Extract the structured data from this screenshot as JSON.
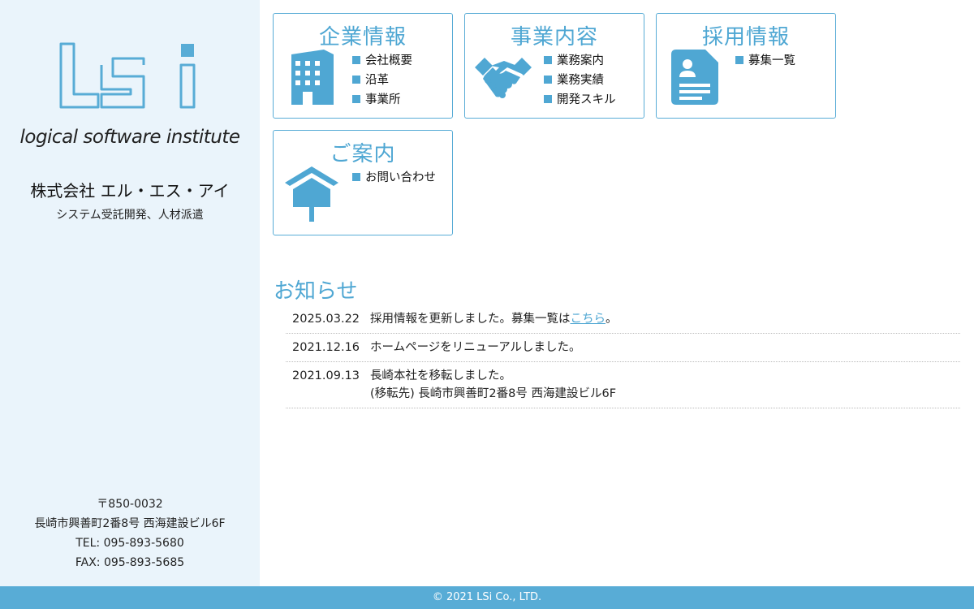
{
  "sidebar": {
    "logo_text": "LSi",
    "tagline": "logical software institute",
    "company_name": "株式会社 エル・エス・アイ",
    "subtitle": "システム受託開発、人材派遣",
    "address": {
      "postal": "〒850-0032",
      "street": "長崎市興善町2番8号 西海建設ビル6F",
      "tel": "TEL: 095-893-5680",
      "fax": "FAX: 095-893-5685"
    }
  },
  "cards": [
    {
      "title": "企業情報",
      "icon": "building-icon",
      "links": [
        "会社概要",
        "沿革",
        "事業所"
      ]
    },
    {
      "title": "事業内容",
      "icon": "handshake-icon",
      "links": [
        "業務案内",
        "業務実績",
        "開発スキル"
      ]
    },
    {
      "title": "採用情報",
      "icon": "document-icon",
      "links": [
        "募集一覧"
      ]
    },
    {
      "title": "ご案内",
      "icon": "signboard-icon",
      "links": [
        "お問い合わせ"
      ]
    }
  ],
  "news": {
    "heading": "お知らせ",
    "items": [
      {
        "date": "2025.03.22",
        "text": "採用情報を更新しました。募集一覧は",
        "link": "こちら",
        "suffix": "。"
      },
      {
        "date": "2021.12.16",
        "text": "ホームページをリニューアルしました。"
      },
      {
        "date": "2021.09.13",
        "text": "長崎本社を移転しました。",
        "text2": "(移転先) 長崎市興善町2番8号 西海建設ビル6F"
      }
    ]
  },
  "footer": {
    "copyright": "© 2021 LSi Co., LTD."
  },
  "colors": {
    "accent": "#58acd6",
    "sidebar_bg": "#eaf4fb",
    "text": "#222222"
  }
}
